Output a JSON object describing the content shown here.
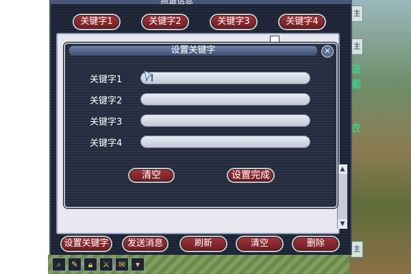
{
  "outer_window": {
    "title": "频道信息",
    "keyword_tabs": [
      "关键字1",
      "关键字2",
      "关键字3",
      "关键字4"
    ],
    "bottom_buttons": [
      "设置关键字",
      "发送消息",
      "刷新",
      "清空",
      "删除"
    ]
  },
  "dialog": {
    "title": "设置关键字",
    "fields": [
      {
        "label": "关键字1",
        "value": ""
      },
      {
        "label": "关键字2",
        "value": ""
      },
      {
        "label": "关键字3",
        "value": ""
      },
      {
        "label": "关键字4",
        "value": ""
      }
    ],
    "clear_label": "清空",
    "done_label": "设置完成",
    "close_symbol": "✕"
  },
  "scene": {
    "tags": [
      "主",
      "主",
      "主"
    ],
    "text_fragments": [
      "法",
      "案",
      "衣"
    ]
  },
  "toolbar_icons": [
    "magnifier-icon",
    "note-icon",
    "lock-icon",
    "sword-icon",
    "chat-icon",
    "menu-icon"
  ]
}
